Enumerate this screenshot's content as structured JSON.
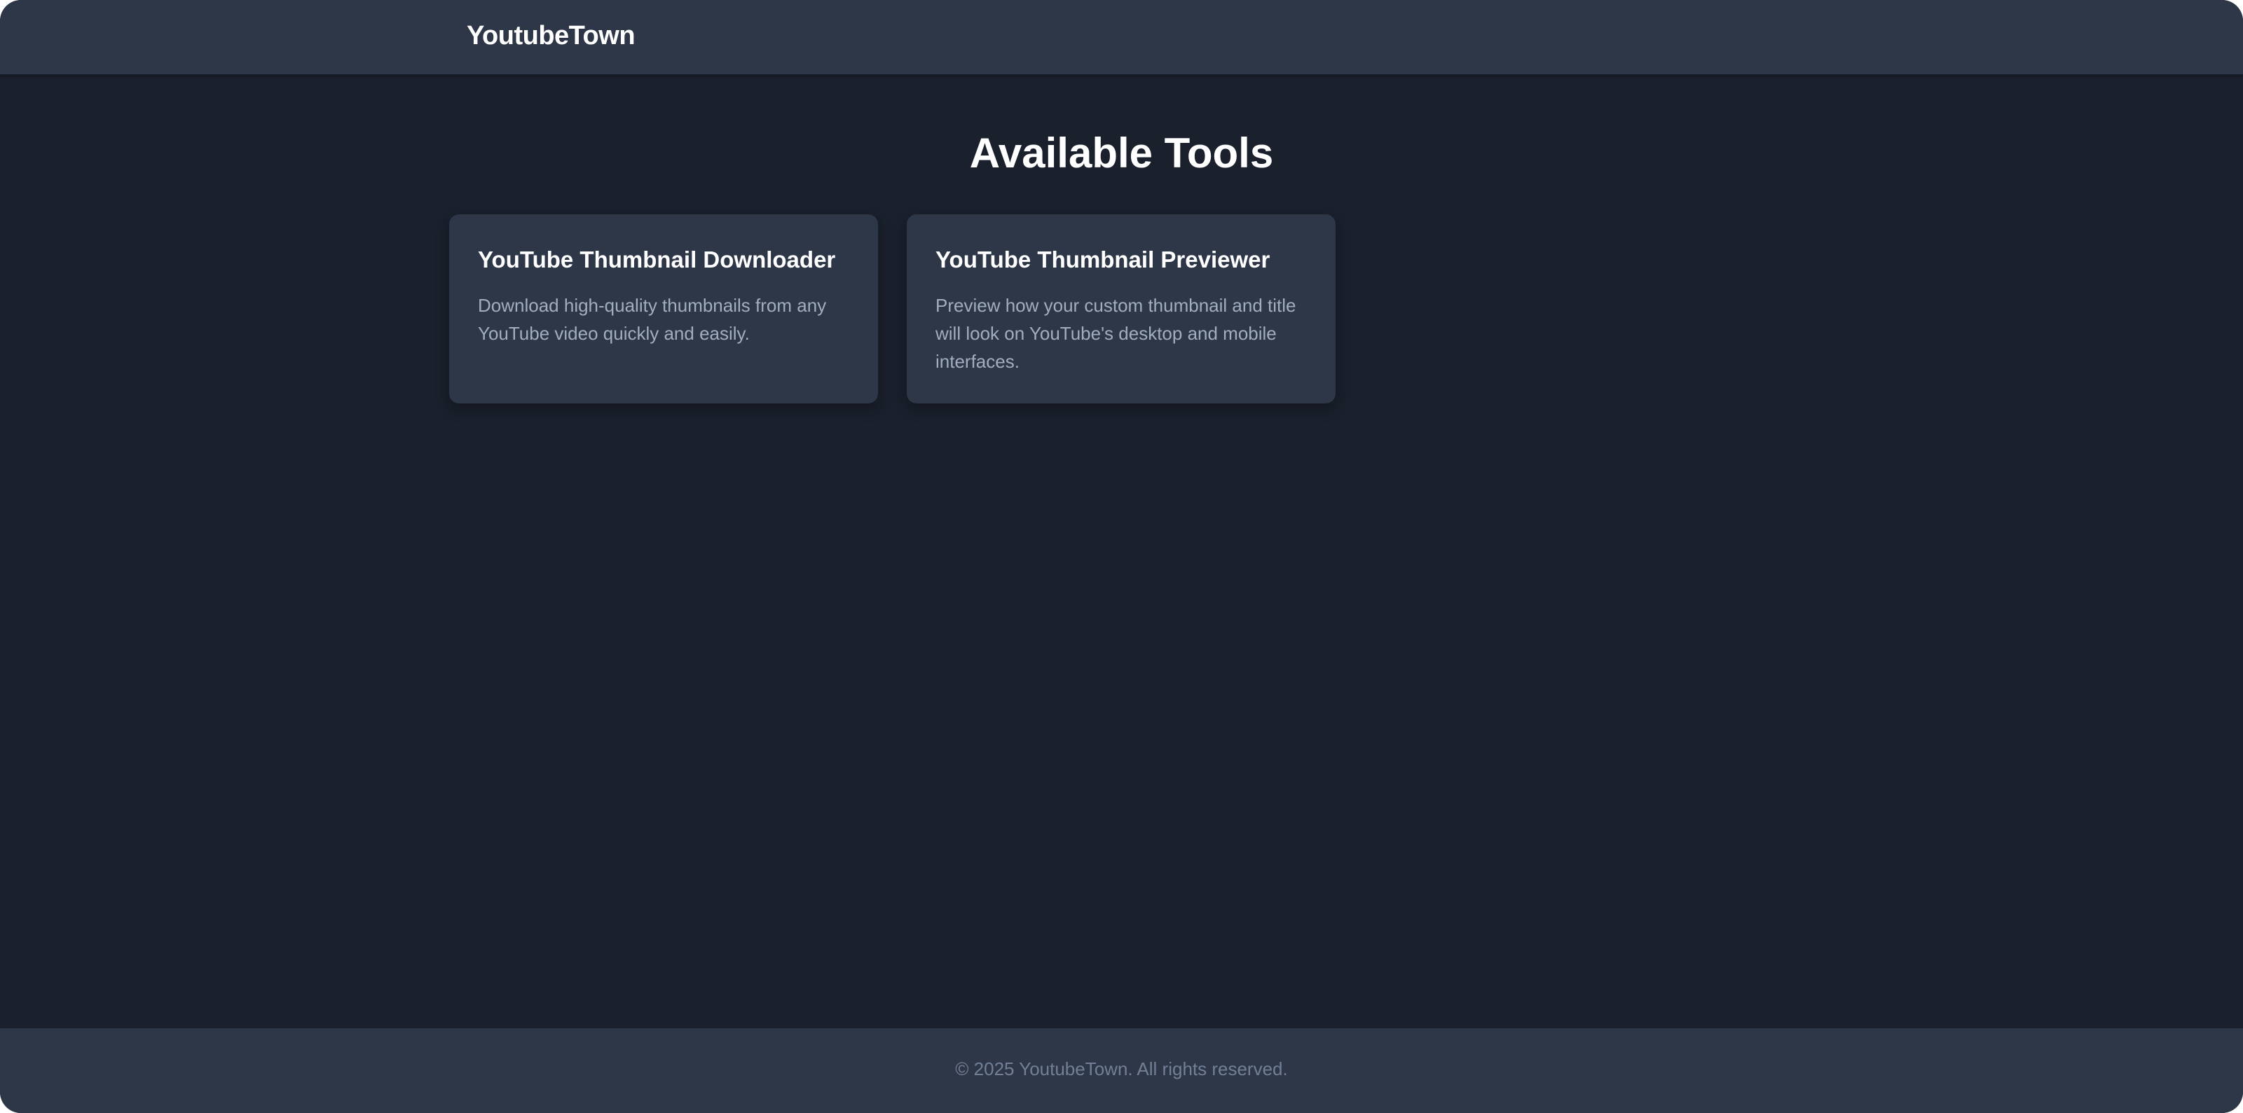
{
  "header": {
    "brand": "YoutubeTown"
  },
  "main": {
    "title": "Available Tools",
    "tools": [
      {
        "title": "YouTube Thumbnail Downloader",
        "description": "Download high-quality thumbnails from any YouTube video quickly and easily."
      },
      {
        "title": "YouTube Thumbnail Previewer",
        "description": "Preview how your custom thumbnail and title will look on YouTube's desktop and mobile interfaces."
      }
    ]
  },
  "footer": {
    "copyright": "© 2025 YoutubeTown. All rights reserved."
  },
  "colors": {
    "background": "#1a202c",
    "surface": "#2d3748",
    "muted_text": "#a0aec0",
    "footer_text": "#718096"
  }
}
